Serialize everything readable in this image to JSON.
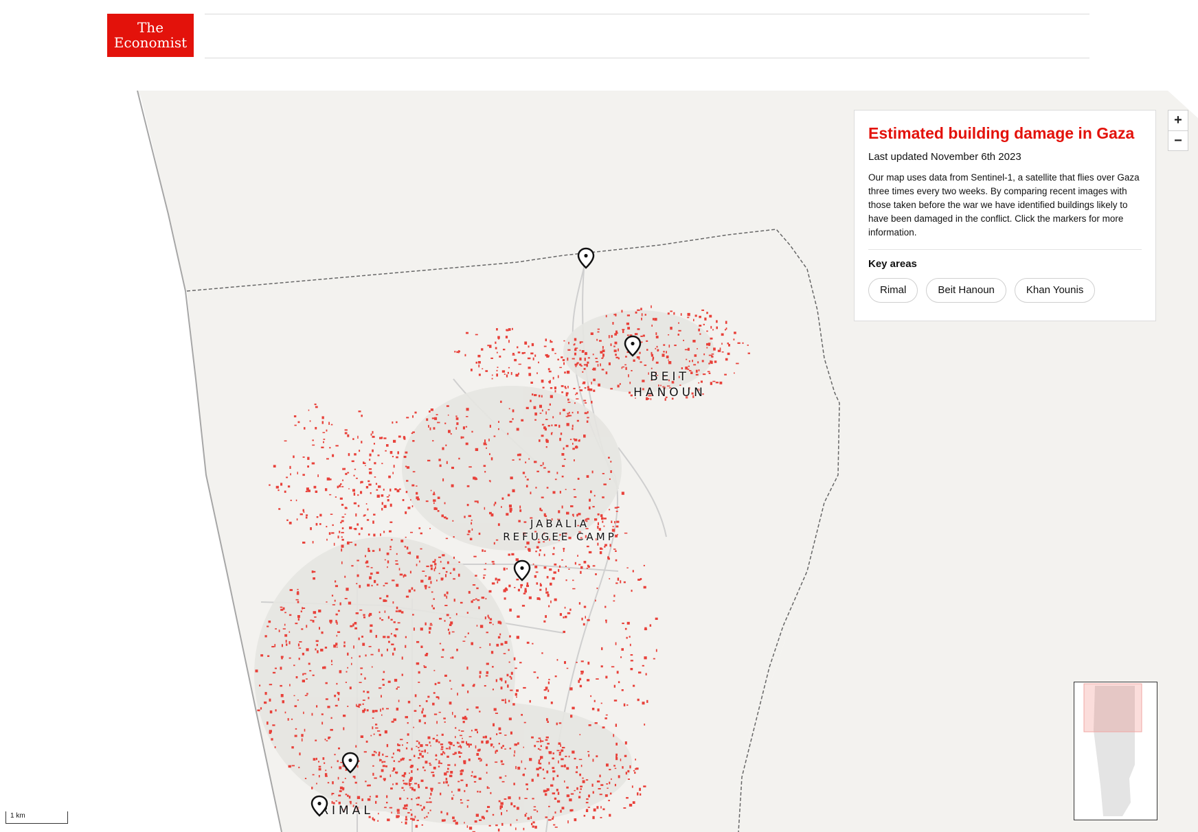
{
  "brand": {
    "line1": "The",
    "line2": "Economist",
    "color": "#e3120b"
  },
  "panel": {
    "title": "Estimated building damage in Gaza",
    "updated": "Last updated November 6th 2023",
    "description": "Our map uses data from Sentinel-1, a satellite that flies over Gaza three times every two weeks. By comparing recent images with those taken before the war we have identified buildings likely to have been damaged in the conflict. Click the markers for more information.",
    "key_areas_heading": "Key areas",
    "key_areas": [
      "Rimal",
      "Beit Hanoun",
      "Khan Younis"
    ]
  },
  "zoom": {
    "in": "+",
    "out": "−"
  },
  "map": {
    "labels": {
      "beit_hanoun_1": "BEIT",
      "beit_hanoun_2": "HANOUN",
      "jabalia_1": "JABALIA",
      "jabalia_2": "REFUGEE CAMP",
      "rimal": "RIMAL"
    },
    "damage_color": "#e8413a",
    "land_color": "#f3f2ef"
  },
  "scale": {
    "label": "1 km"
  }
}
